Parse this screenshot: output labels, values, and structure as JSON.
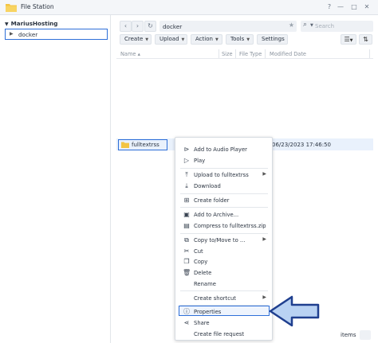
{
  "window": {
    "title": "File Station",
    "buttons": [
      "?",
      "—",
      "□",
      "✕"
    ]
  },
  "sidebar": {
    "root": "MariusHosting",
    "items": [
      {
        "label": "docker"
      }
    ]
  },
  "toolbar": {
    "path": "docker",
    "search_placeholder": "Search",
    "buttons": {
      "create": "Create",
      "upload": "Upload",
      "action": "Action",
      "tools": "Tools",
      "settings": "Settings"
    }
  },
  "columns": {
    "name": "Name",
    "name_sort": "▴",
    "size": "Size",
    "file_type": "File Type",
    "modified": "Modified Date"
  },
  "files": [
    {
      "name": "fulltextrss",
      "modified": "06/23/2023 17:46:50"
    }
  ],
  "context_menu": {
    "items": [
      {
        "label": "Add to Audio Player",
        "icon": "add-to-playlist-icon"
      },
      {
        "label": "Play",
        "icon": "play-icon"
      },
      {
        "label": "Upload to fulltextrss",
        "icon": "upload-icon",
        "submenu": true
      },
      {
        "label": "Download",
        "icon": "download-icon"
      },
      {
        "label": "Create folder",
        "icon": "new-folder-icon"
      },
      {
        "label": "Add to Archive...",
        "icon": "archive-icon"
      },
      {
        "label": "Compress to fulltextrss.zip",
        "icon": "compress-icon"
      },
      {
        "label": "Copy to/Move to ...",
        "icon": "copy-move-icon",
        "submenu": true
      },
      {
        "label": "Cut",
        "icon": "cut-icon"
      },
      {
        "label": "Copy",
        "icon": "copy-icon"
      },
      {
        "label": "Delete",
        "icon": "delete-icon"
      },
      {
        "label": "Rename",
        "icon": ""
      },
      {
        "label": "Create shortcut",
        "icon": "",
        "submenu": true
      },
      {
        "label": "Properties",
        "icon": "info-icon",
        "selected": true
      },
      {
        "label": "Share",
        "icon": "share-icon"
      },
      {
        "label": "Create file request",
        "icon": ""
      }
    ]
  },
  "status": {
    "items_label": "items"
  },
  "colors": {
    "accent": "#2e6fd8",
    "arrow_fill": "#b9d2f3",
    "arrow_stroke": "#1f3f8f",
    "folder": "#f3c443"
  }
}
